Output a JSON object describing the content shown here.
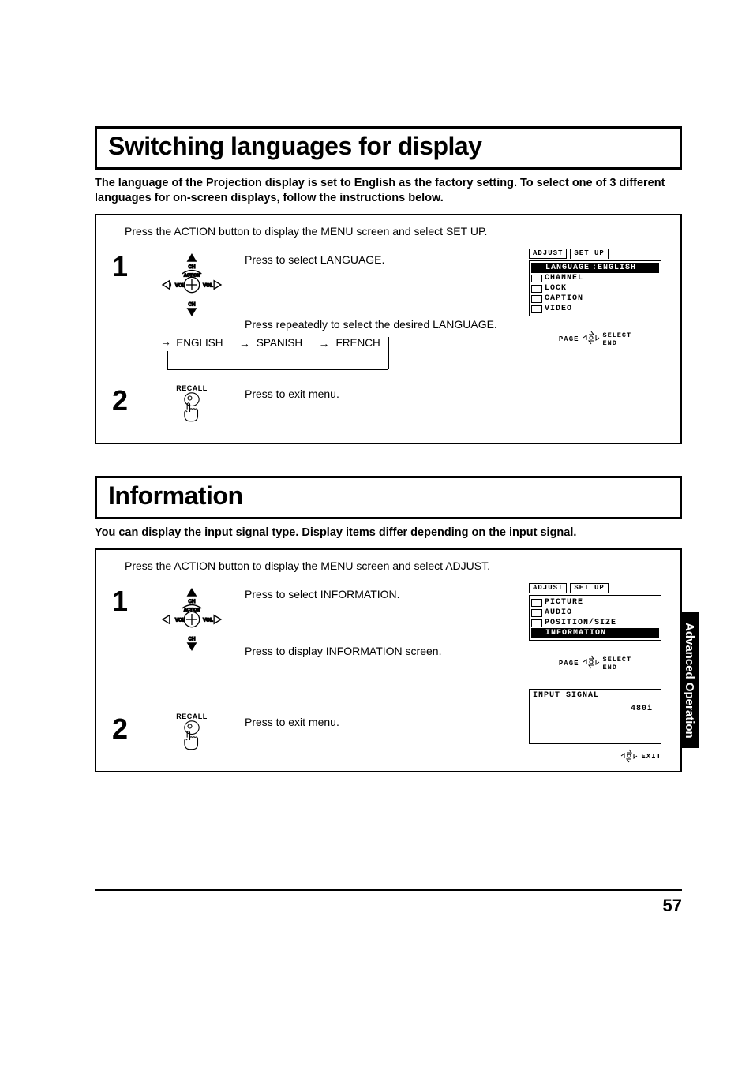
{
  "page_number": "57",
  "side_tab": "Advanced Operation",
  "section1": {
    "title": "Switching languages for display",
    "intro": "The language of the Projection display is set to English as the factory setting. To select one of 3 different languages for on-screen displays, follow the instructions below.",
    "preline": "Press the ACTION button to display the MENU screen and select SET UP.",
    "step1_a": "Press to select LANGUAGE.",
    "step1_b": "Press repeatedly to select  the desired LANGUAGE.",
    "cycle": [
      "ENGLISH",
      "SPANISH",
      "FRENCH"
    ],
    "step2": "Press to exit menu.",
    "recall_label": "RECALL",
    "osd": {
      "tab_left": "ADJUST",
      "tab_right": "SET UP",
      "rows": [
        {
          "label": "LANGUAGE",
          "value": ":ENGLISH",
          "hl": true
        },
        {
          "label": "CHANNEL"
        },
        {
          "label": "LOCK"
        },
        {
          "label": "CAPTION"
        },
        {
          "label": "VIDEO"
        }
      ],
      "footer_l": "PAGE",
      "footer_r1": "SELECT",
      "footer_r2": "END"
    }
  },
  "section2": {
    "title": "Information",
    "intro": "You can display the input signal type. Display items differ depending on the input signal.",
    "preline": "Press the ACTION button to display the MENU screen and select ADJUST.",
    "step1_a": "Press to select INFORMATION.",
    "step1_b": "Press to display INFORMATION screen.",
    "step2": "Press to exit menu.",
    "recall_label": "RECALL",
    "osd": {
      "tab_left": "ADJUST",
      "tab_right": "SET UP",
      "rows": [
        {
          "label": "PICTURE"
        },
        {
          "label": "AUDIO"
        },
        {
          "label": "POSITION/SIZE"
        },
        {
          "label": "INFORMATION",
          "hl": true
        }
      ],
      "footer_l": "PAGE",
      "footer_r1": "SELECT",
      "footer_r2": "END"
    },
    "input_signal": {
      "title": "INPUT SIGNAL",
      "value": "480i",
      "exit": "EXIT"
    }
  }
}
